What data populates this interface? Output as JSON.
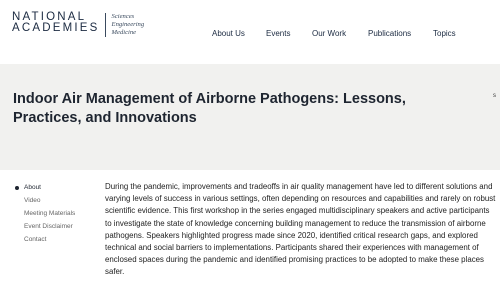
{
  "logo": {
    "line1": "NATIONAL",
    "line2": "ACADEMIES",
    "sub1": "Sciences",
    "sub2": "Engineering",
    "sub3": "Medicine"
  },
  "nav": {
    "items": [
      "About Us",
      "Events",
      "Our Work",
      "Publications",
      "Topics"
    ]
  },
  "page": {
    "title": "Indoor Air Management of Airborne Pathogens: Lessons, Practices, and Innovations",
    "edge_text": "s"
  },
  "sidebar": {
    "items": [
      "About",
      "Video",
      "Meeting Materials",
      "Event Disclaimer",
      "Contact"
    ],
    "active": "About"
  },
  "body": {
    "text": "During the pandemic, improvements and tradeoffs in air quality management have led to different solutions and varying levels of success in various settings, often depending on resources and capabilities and rarely on robust scientific evidence. This first workshop in the series engaged multidisciplinary speakers and active participants to investigate the state of knowledge concerning building management to reduce the transmission of airborne pathogens. Speakers highlighted progress made since 2020, identified critical research gaps, and explored technical and social barriers to implementations. Participants shared their experiences with management of enclosed spaces during the pandemic and identified promising practices to be adopted to make these places safer."
  },
  "colors": {
    "brand": "#1b2a41",
    "hero_bg": "#f1f1ef"
  }
}
